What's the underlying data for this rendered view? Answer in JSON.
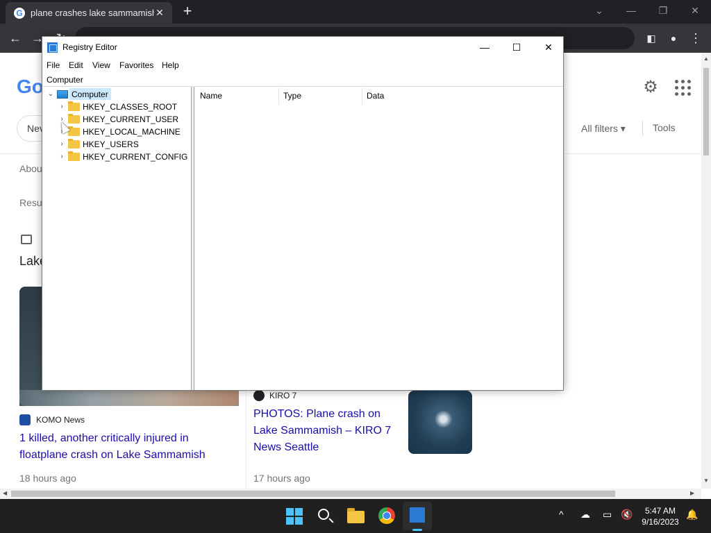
{
  "chrome": {
    "tab_title": "plane crashes lake sammamish -",
    "tab_close": "✕",
    "new_tab": "+",
    "win_min": "—",
    "win_restore": "❐",
    "win_close": "✕",
    "back": "←",
    "forward": "→",
    "reload": "↻",
    "menu": "⋮"
  },
  "google": {
    "logo": "Go",
    "news_chip": "Nev",
    "all_filters": "All filters ▾",
    "tools": "Tools",
    "about": "Abou",
    "results": "Resu",
    "section_title": "Lake",
    "cards": [
      {
        "source": "KOMO News",
        "title": "1 killed, another critically injured in floatplane crash on Lake Sammamish",
        "time": "18 hours ago",
        "badge_color": "#1e4fa3"
      },
      {
        "source": "KIRO 7",
        "title": "PHOTOS: Plane crash on Lake Sammamish – KIRO 7 News Seattle",
        "time": "17 hours ago",
        "badge_color": "#202124"
      }
    ]
  },
  "regedit": {
    "title": "Registry Editor",
    "ctrl_min": "—",
    "ctrl_max": "☐",
    "ctrl_close": "✕",
    "menu": [
      "File",
      "Edit",
      "View",
      "Favorites",
      "Help"
    ],
    "address": "Computer",
    "tree_root": "Computer",
    "tree_items": [
      "HKEY_CLASSES_ROOT",
      "HKEY_CURRENT_USER",
      "HKEY_LOCAL_MACHINE",
      "HKEY_USERS",
      "HKEY_CURRENT_CONFIG"
    ],
    "columns": [
      "Name",
      "Type",
      "Data"
    ]
  },
  "taskbar": {
    "time": "5:47 AM",
    "date": "9/16/2023",
    "tray_chevron": "^",
    "icons": [
      "windows-icon",
      "search-icon",
      "file-explorer-icon",
      "chrome-icon",
      "registry-editor-icon"
    ]
  }
}
